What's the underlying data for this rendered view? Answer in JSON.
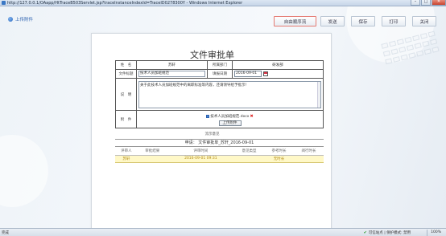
{
  "window": {
    "title": "http://127.0.0.1/OAapp/HtTraceB503Servlet.jsp?traceInstanceIndexId=TraceID0278300Y - Windows Internet Explorer",
    "minimize": "–",
    "maximize": "□",
    "close": "✕"
  },
  "toolbar": {
    "upload_attachment": "上传附件",
    "free_flow": "自由顺序流",
    "send": "发送",
    "save": "保存",
    "print": "打印",
    "close": "关闭"
  },
  "document": {
    "title": "文件审批单",
    "fields": {
      "name_label": "姓　名",
      "name_value": "苏轩",
      "dept_label": "所属部门",
      "dept_value": "研发部",
      "file_title_label": "文件标题",
      "file_title_value": "技术人员加班规范",
      "apply_date_label": "填报日期",
      "apply_date_value": "2016-09-01",
      "description_label": "说　明",
      "description_value": "关于此技术人员加班规范中的离职标准等内容，还请领导给予批示！",
      "attachment_label": "附　件",
      "attachment_file": "技术人员加班规范.docx",
      "upload_button": "上传附件"
    },
    "flow_section_title": "流示意见",
    "flow_header": "申请： 文件审批单_苏轩_2016-09-01",
    "flow_columns": [
      "评审人",
      "审批结果",
      "评审时间",
      "意见类型",
      "参考时长",
      "阅行时长"
    ],
    "flow_rows": [
      [
        "苏轩",
        "",
        "2016-09-01 09:31",
        "",
        "无时长",
        ""
      ]
    ]
  },
  "statusbar": {
    "left": "完成",
    "zone": "可信站点 | 保护模式: 禁用",
    "zoom": "100%"
  },
  "colors": {
    "accent": "#2f64b1",
    "highlight_border": "#e57a72",
    "row_highlight": "#fff8c7"
  }
}
